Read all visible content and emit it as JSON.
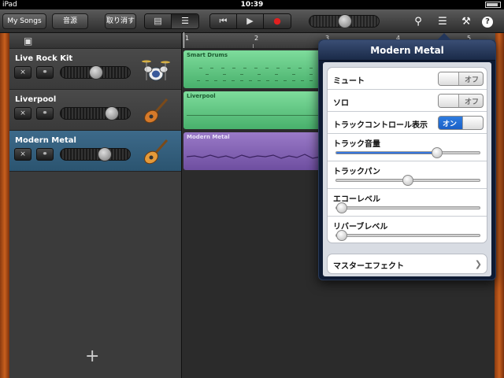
{
  "status": {
    "device": "iPad",
    "time": "10:39"
  },
  "toolbar": {
    "my_songs": "My Songs",
    "sound_source": "音源",
    "undo": "取り消す",
    "info_icon": "?"
  },
  "ruler": {
    "marks": [
      "1",
      "2",
      "3",
      "4",
      "5"
    ]
  },
  "tracks": [
    {
      "name": "Live Rock Kit",
      "instrument": "drum-kit-icon",
      "volume": 0.5
    },
    {
      "name": "Liverpool",
      "instrument": "electric-guitar-icon",
      "volume": 0.78
    },
    {
      "name": "Modern Metal",
      "instrument": "electric-guitar-icon",
      "volume": 0.65
    }
  ],
  "regions": [
    {
      "name": "Smart Drums",
      "color": "#6fd08e"
    },
    {
      "name": "Liverpool",
      "color": "#6fd08e"
    },
    {
      "name": "Modern Metal",
      "color": "#8a68bc"
    }
  ],
  "popover": {
    "title": "Modern Metal",
    "mute": {
      "label": "ミュート",
      "state": "オフ"
    },
    "solo": {
      "label": "ソロ",
      "state": "オフ"
    },
    "track_controls": {
      "label": "トラックコントロール表示",
      "state": "オン"
    },
    "track_volume": {
      "label": "トラック音量",
      "value": 0.72
    },
    "track_pan": {
      "label": "トラックパン",
      "value": 0.5
    },
    "echo_level": {
      "label": "エコーレベル",
      "value": 0.0
    },
    "reverb_level": {
      "label": "リバーブレベル",
      "value": 0.0
    },
    "master_effects": {
      "label": "マスターエフェクト"
    }
  },
  "add_track": "+"
}
